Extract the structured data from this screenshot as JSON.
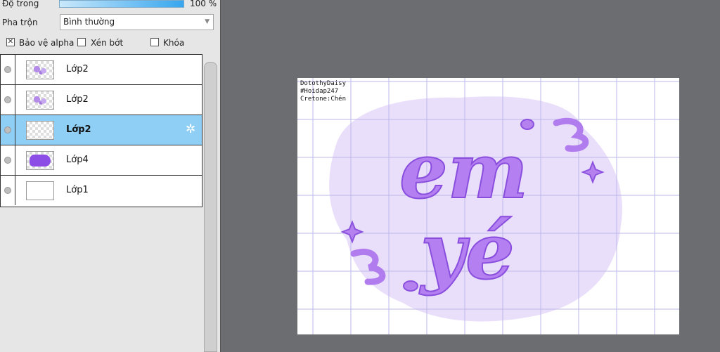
{
  "properties": {
    "opacity_label": "Độ trong",
    "opacity_value": "100 %",
    "blend_label": "Pha trộn",
    "blend_value": "Bình thường",
    "protect_alpha_label": "Bảo vệ alpha",
    "protect_alpha_checked": true,
    "clip_label": "Xén bớt",
    "lock_label": "Khóa"
  },
  "layers": [
    {
      "name": "Lớp2",
      "thumb": "lettering",
      "selected": false
    },
    {
      "name": "Lớp2",
      "thumb": "lettering",
      "selected": false
    },
    {
      "name": "Lớp2",
      "thumb": "empty",
      "selected": true
    },
    {
      "name": "Lớp4",
      "thumb": "blob",
      "selected": false
    },
    {
      "name": "Lớp1",
      "thumb": "white",
      "selected": false
    }
  ],
  "canvas": {
    "credits": [
      "DotothyDaisy",
      "#Hoidap247",
      "Cretone:Chén"
    ],
    "lettering_line1": "em",
    "lettering_line2": "yé",
    "colors": {
      "blob": "#e8dcfb",
      "letter": "#b480ee",
      "letter_dark": "#8a4ede",
      "grid": "#b9b4e6",
      "selection": "#8fcff6"
    }
  }
}
